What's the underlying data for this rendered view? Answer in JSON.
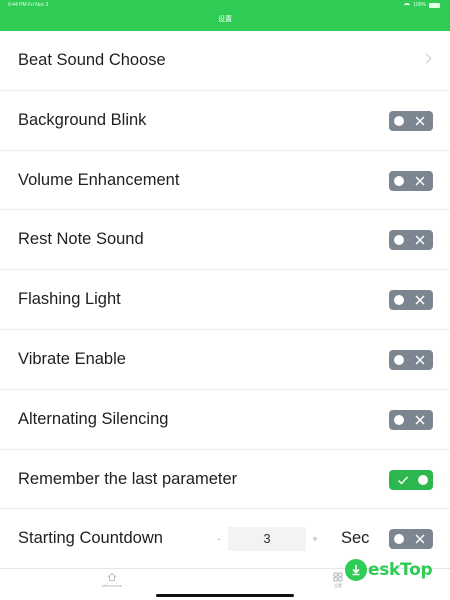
{
  "status_bar": {
    "time": "9:44 PM",
    "date": "Fri Nov 3",
    "battery": "100%"
  },
  "header": {
    "title": "设置"
  },
  "rows": [
    {
      "label": "Beat Sound Choose",
      "control": "chevron"
    },
    {
      "label": "Background Blink",
      "control": "toggle",
      "on": false
    },
    {
      "label": "Volume Enhancement",
      "control": "toggle",
      "on": false
    },
    {
      "label": "Rest Note Sound",
      "control": "toggle",
      "on": false
    },
    {
      "label": "Flashing Light",
      "control": "toggle",
      "on": false
    },
    {
      "label": "Vibrate Enable",
      "control": "toggle",
      "on": false
    },
    {
      "label": "Alternating Silencing",
      "control": "toggle",
      "on": false
    },
    {
      "label": "Remember the last parameter",
      "control": "toggle",
      "on": true
    },
    {
      "label": "Starting Countdown",
      "control": "stepper-toggle",
      "on": false
    }
  ],
  "countdown": {
    "minus": "-",
    "value": "3",
    "plus": "+",
    "unit": "Sec"
  },
  "tabbar": {
    "home_label": "Metronome",
    "settings_label": "设置"
  },
  "watermark": {
    "text": "eskTop"
  },
  "colors": {
    "accent": "#2ecc55",
    "toggle_off": "#7b8690",
    "toggle_on": "#2db84f"
  }
}
